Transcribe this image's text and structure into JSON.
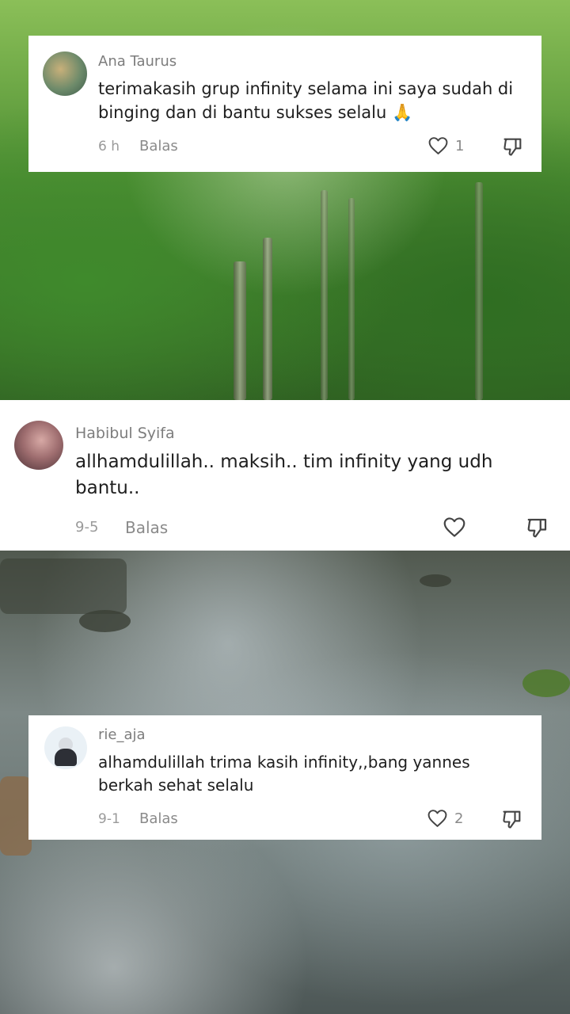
{
  "comments": [
    {
      "username": "Ana Taurus",
      "text": "terimakasih grup infinity selama ini saya sudah di binging dan di bantu sukses selalu 🙏",
      "time": "6 h",
      "reply_label": "Balas",
      "like_count": "1"
    },
    {
      "username": "Habibul Syifa",
      "text": "allhamdulillah.. maksih.. tim infinity yang udh bantu..",
      "time": "9-5",
      "reply_label": "Balas",
      "like_count": ""
    },
    {
      "username": "rie_aja",
      "text": "alhamdulillah trima kasih infinity,,bang yannes berkah sehat selalu",
      "time": "9-1",
      "reply_label": "Balas",
      "like_count": "2"
    }
  ],
  "icons": {
    "like": "heart-outline-icon",
    "dislike": "thumbs-down-outline-icon"
  },
  "colors": {
    "card_bg": "#ffffff",
    "username": "#7d7d7d",
    "text": "#1e1e1e",
    "meta": "#9a9a9a"
  }
}
